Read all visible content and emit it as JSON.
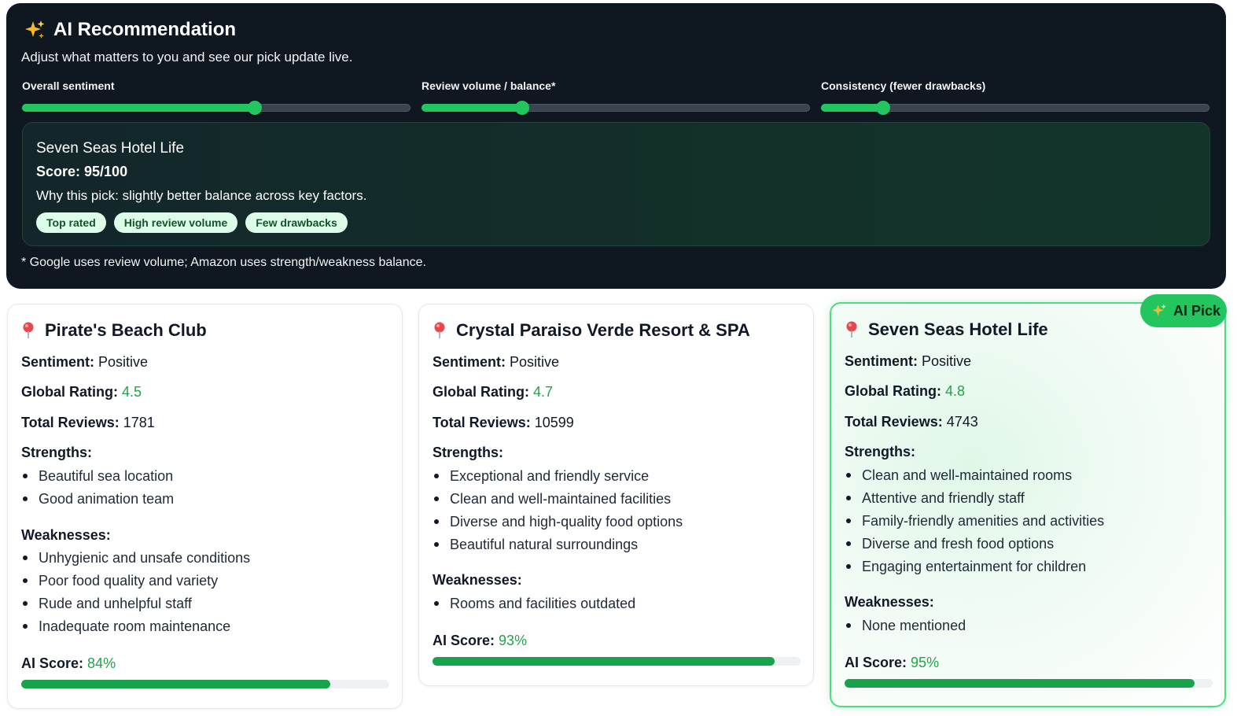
{
  "panel": {
    "title": "AI Recommendation",
    "subtitle": "Adjust what matters to you and see our pick update live.",
    "sliders": [
      {
        "label": "Overall sentiment",
        "value": 0.6
      },
      {
        "label": "Review volume / balance*",
        "value": 0.26
      },
      {
        "label": "Consistency (fewer drawbacks)",
        "value": 0.16
      }
    ],
    "pick": {
      "name": "Seven Seas Hotel Life",
      "score": "Score: 95/100",
      "why": "Why this pick: slightly better balance across key factors.",
      "chips": [
        "Top rated",
        "High review volume",
        "Few drawbacks"
      ]
    },
    "footnote": "* Google uses review volume; Amazon uses strength/weakness balance."
  },
  "labels": {
    "sentiment": "Sentiment:",
    "rating": "Global Rating:",
    "reviews": "Total Reviews:",
    "strengths": "Strengths:",
    "weaknesses": "Weaknesses:",
    "ai_score": "AI Score:"
  },
  "badge": "AI Pick",
  "cards": [
    {
      "name": "Pirate's Beach Club",
      "sentiment": "Positive",
      "rating": "4.5",
      "reviews": "1781",
      "strengths": [
        "Beautiful sea location",
        "Good animation team"
      ],
      "weaknesses": [
        "Unhygienic and unsafe conditions",
        "Poor food quality and variety",
        "Rude and unhelpful staff",
        "Inadequate room maintenance"
      ],
      "ai_score": "84%",
      "ai_score_value": 0.84
    },
    {
      "name": "Crystal Paraiso Verde Resort & SPA",
      "sentiment": "Positive",
      "rating": "4.7",
      "reviews": "10599",
      "strengths": [
        "Exceptional and friendly service",
        "Clean and well-maintained facilities",
        "Diverse and high-quality food options",
        "Beautiful natural surroundings"
      ],
      "weaknesses": [
        "Rooms and facilities outdated"
      ],
      "ai_score": "93%",
      "ai_score_value": 0.93
    },
    {
      "name": "Seven Seas Hotel Life",
      "sentiment": "Positive",
      "rating": "4.8",
      "reviews": "4743",
      "strengths": [
        "Clean and well-maintained rooms",
        "Attentive and friendly staff",
        "Family-friendly amenities and activities",
        "Diverse and fresh food options",
        "Engaging entertainment for children"
      ],
      "weaknesses": [
        "None mentioned"
      ],
      "ai_score": "95%",
      "ai_score_value": 0.95
    }
  ],
  "colors": {
    "accent": "#22c55e",
    "panel_bg": "#0f1720",
    "score_text": "#22a447"
  },
  "icons": {
    "title": "sparkles-icon",
    "card": "map-pin-icon"
  }
}
